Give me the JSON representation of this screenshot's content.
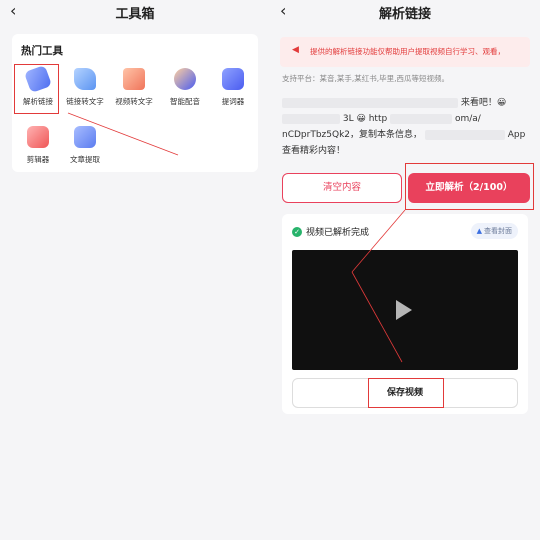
{
  "left": {
    "title": "工具箱",
    "back_glyph": "‹",
    "section_title": "热门工具",
    "tools": [
      {
        "label": "解析链接",
        "icon": "sparkle-link-icon",
        "color": "#5b7cf0"
      },
      {
        "label": "链接转文字",
        "icon": "pen-icon",
        "color": "#6aa3f5"
      },
      {
        "label": "视频转文字",
        "icon": "video-play-icon",
        "color": "#f0866b"
      },
      {
        "label": "智能配音",
        "icon": "voice-icon",
        "color": "#5a6ef2"
      },
      {
        "label": "提词器",
        "icon": "prompter-icon",
        "color": "#5a6ef2"
      },
      {
        "label": "剪辑器",
        "icon": "clip-icon",
        "color": "#f06a6a"
      },
      {
        "label": "文章提取",
        "icon": "article-extract-icon",
        "color": "#6d8ff5"
      }
    ]
  },
  "right": {
    "title": "解析链接",
    "back_glyph": "‹",
    "notice": "提供的解析链接功能仅帮助用户提取视频自行学习、观看，",
    "platforms": "支持平台：某音,某手,某红书,毕里,西瓜等短视频。",
    "pasted_text": {
      "line1_visible": "来看吧！😀",
      "line2_visible": "3L 😀 http",
      "line2_tail": "om/a/",
      "line3": "nCDprTbz5Qk2，复制本条信息，",
      "line3_tail": "App",
      "line4": "查看精彩内容！"
    },
    "clear_button": "清空内容",
    "parse_button": "立即解析（2/100）",
    "status": "视频已解析完成",
    "cover_button": "查看封面",
    "save_button": "保存视频"
  },
  "colors": {
    "accent": "#e9415c",
    "annotation": "#e23a3a",
    "success": "#27b36b"
  }
}
